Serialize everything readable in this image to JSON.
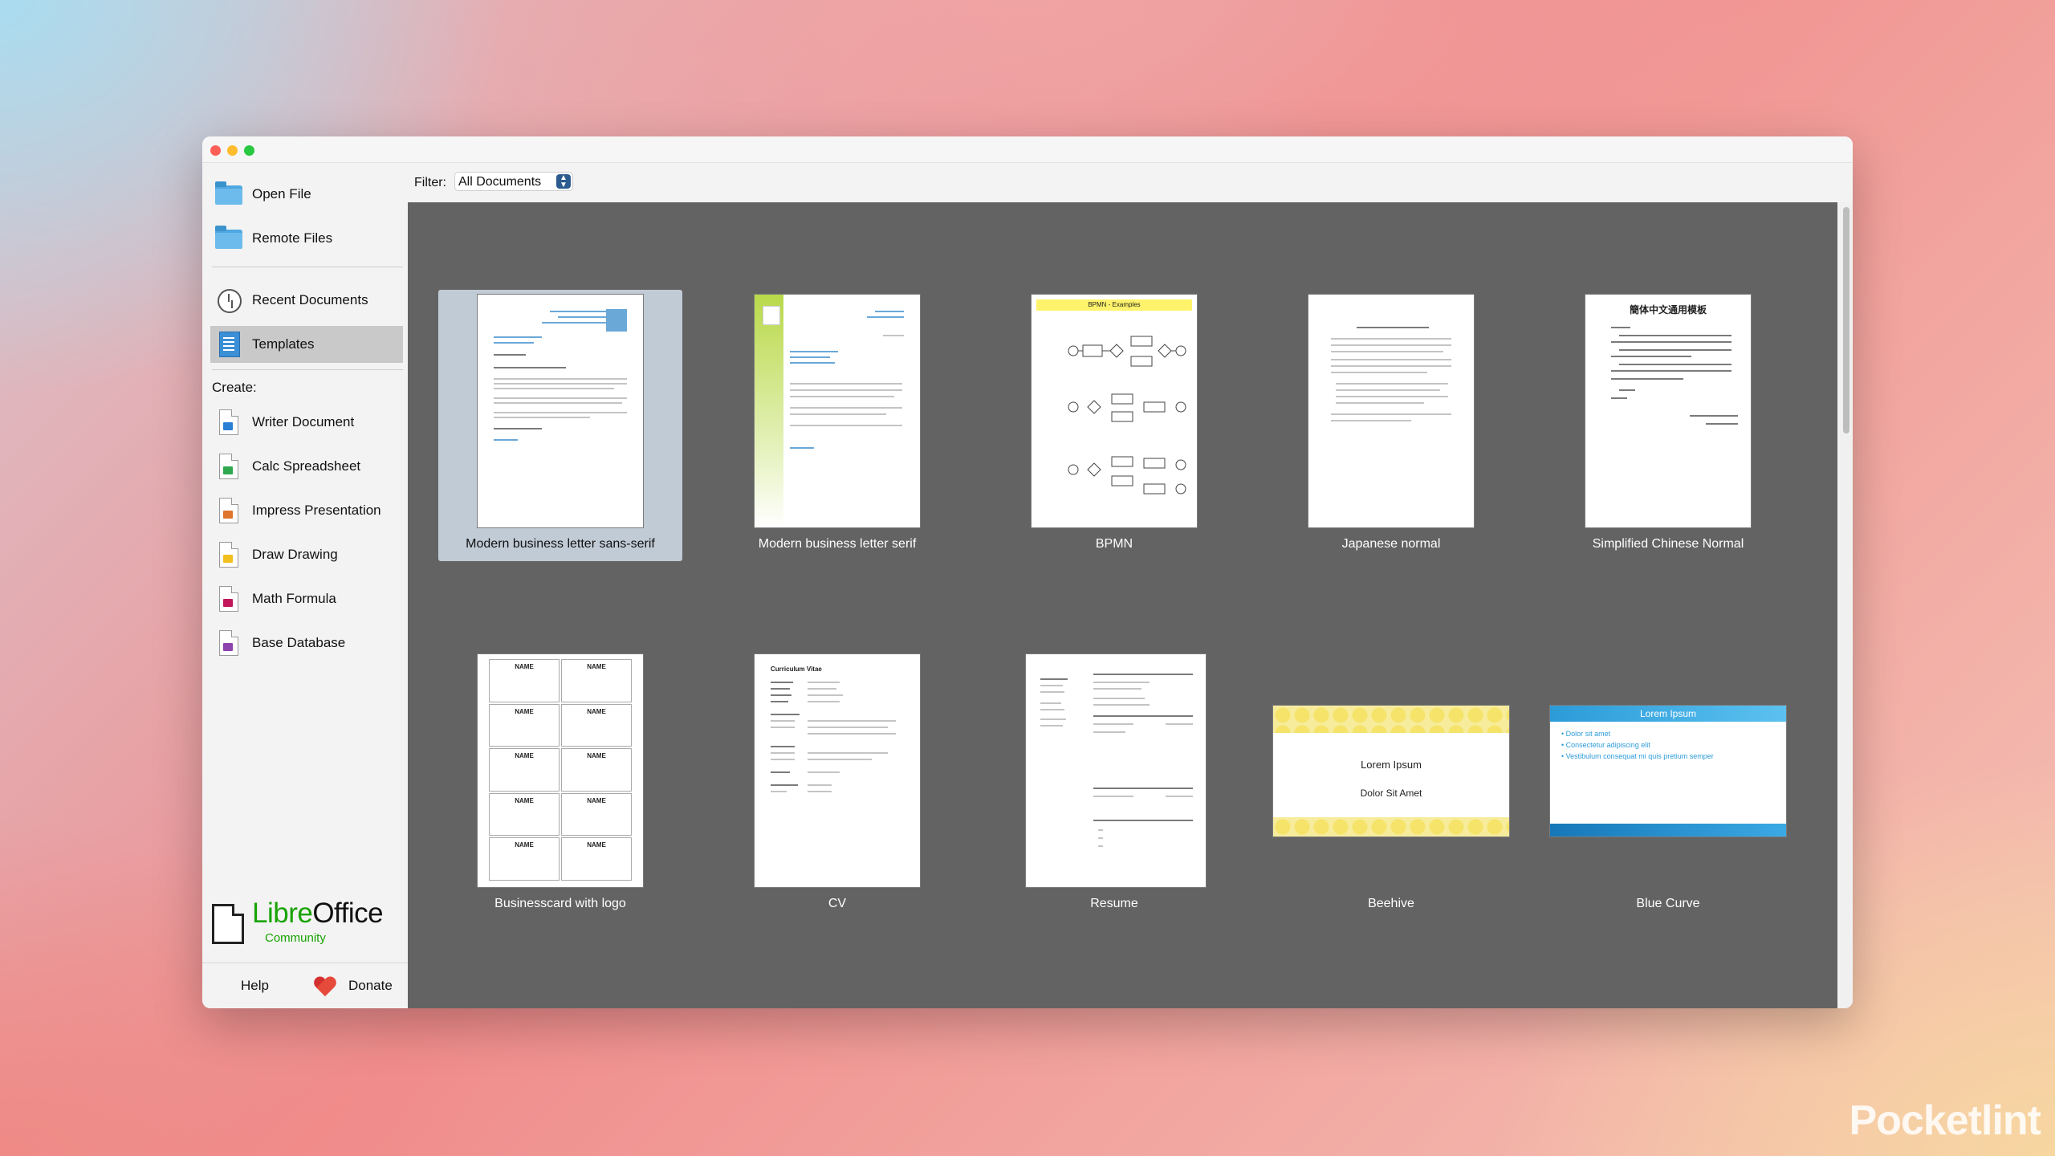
{
  "sidebar": {
    "open_file": "Open File",
    "remote_files": "Remote Files",
    "recent_documents": "Recent Documents",
    "templates": "Templates",
    "create_label": "Create:",
    "create_items": {
      "writer": "Writer Document",
      "calc": "Calc Spreadsheet",
      "impress": "Impress Presentation",
      "draw": "Draw Drawing",
      "math": "Math Formula",
      "base": "Base Database"
    },
    "logo": {
      "libre": "Libre",
      "office": "Office",
      "sub": "Community"
    },
    "help": "Help",
    "donate": "Donate"
  },
  "filter": {
    "label": "Filter:",
    "value": "All Documents"
  },
  "templates": [
    {
      "label": "Modern business letter sans-serif",
      "selected": true
    },
    {
      "label": "Modern business letter serif"
    },
    {
      "label": "BPMN",
      "thumb_title": "BPMN - Examples"
    },
    {
      "label": "Japanese normal"
    },
    {
      "label": "Simplified Chinese Normal",
      "thumb_title": "簡体中文通用模板"
    },
    {
      "label": "Businesscard with logo",
      "thumb_text": "NAME"
    },
    {
      "label": "CV",
      "thumb_title": "Curriculum Vitae"
    },
    {
      "label": "Resume"
    },
    {
      "label": "Beehive",
      "thumb_title": "Lorem Ipsum",
      "thumb_subtitle": "Dolor Sit Amet"
    },
    {
      "label": "Blue Curve",
      "thumb_title": "Lorem Ipsum",
      "thumb_bullets": [
        "Dolor sit amet",
        "Consectetur adipiscing elit",
        "Vestibulum consequat mi quis pretium semper"
      ]
    }
  ],
  "watermark": "Pocketlint",
  "colors": {
    "libre_green": "#18a303",
    "selection": "#c1cbd6",
    "grid_bg": "#636363",
    "folder_blue": "#4fa8e0"
  }
}
